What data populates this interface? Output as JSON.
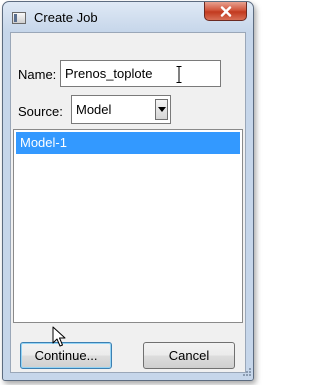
{
  "window": {
    "title": "Create Job"
  },
  "form": {
    "name_label": "Name:",
    "name_value": "Prenos_toplote",
    "source_label": "Source:",
    "source_value": "Model"
  },
  "model_list": {
    "items": [
      "Model-1"
    ],
    "selected_index": 0
  },
  "buttons": {
    "continue_label": "Continue...",
    "cancel_label": "Cancel"
  },
  "colors": {
    "selection": "#3399ff",
    "close_button": "#c23a1f",
    "title_gradient": "#c6d6ea"
  },
  "icons": {
    "app": "window-icon",
    "close": "close-x-icon",
    "dropdown": "chevron-down-icon",
    "text_cursor": "ibeam-cursor-icon",
    "pointer": "mouse-pointer-icon",
    "resize": "resize-grip-icon"
  }
}
